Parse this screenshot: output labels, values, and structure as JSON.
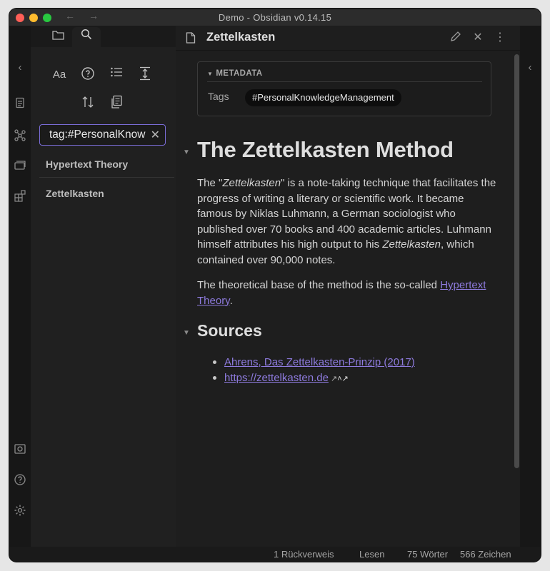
{
  "window": {
    "title": "Demo - Obsidian v0.14.15"
  },
  "sidebar": {
    "search": {
      "query": "tag:#PersonalKnow",
      "clear_icon": "close-icon"
    },
    "results": [
      "Hypertext Theory",
      "Zettelkasten"
    ]
  },
  "note": {
    "title": "Zettelkasten",
    "metadata": {
      "heading": "METADATA",
      "tags_label": "Tags",
      "tag": "#PersonalKnowledgeManagement"
    },
    "h1": "The Zettelkasten Method",
    "p1": {
      "pre": "The \"",
      "em1": "Zettelkasten",
      "mid": "\" is a note-taking technique that facilitates the progress of writing a literary or scientific work. It became famous by Niklas Luhmann, a German sociologist who published over 70 books and 400 academic articles. Luhmann himself attributes his high output to his ",
      "em2": "Zettelkasten",
      "post": ", which contained over 90,000 notes."
    },
    "p2": {
      "pre": "The theoretical base of the method is the so-called ",
      "link": "Hypertext Theory",
      "post": "."
    },
    "h2": "Sources",
    "sources": [
      "Ahrens, Das Zettelkasten-Prinzip (2017)",
      "https://zettelkasten.de"
    ]
  },
  "status": {
    "backlinks": "1 Rückverweis",
    "mode": "Lesen",
    "words": "75 Wörter",
    "chars": "566 Zeichen"
  },
  "colors": {
    "accent": "#7a6cd6",
    "link": "#8e7bde",
    "background": "#1e1e1e"
  }
}
